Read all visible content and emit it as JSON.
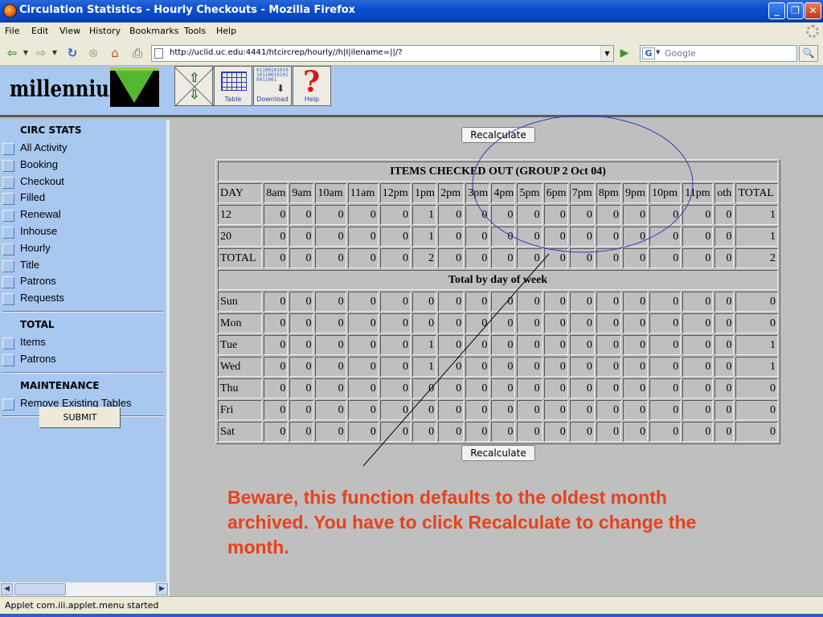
{
  "window": {
    "title": "Circulation Statistics - Hourly Checkouts - Mozilla Firefox"
  },
  "menubar": [
    "File",
    "Edit",
    "View",
    "History",
    "Bookmarks",
    "Tools",
    "Help"
  ],
  "nav": {
    "url": "http://uclid.uc.edu:4441/htcircrep/hourly//h|I|ilename=||/?",
    "search_placeholder": "Google",
    "search_engine_glyph": "G"
  },
  "header": {
    "logo_text": "millennium",
    "tools": {
      "table": "Table",
      "download": "Download",
      "help": "Help"
    },
    "download_bits": "01100101010101100101010011001"
  },
  "sidebar": {
    "sections": [
      {
        "title": "CIRC STATS",
        "items": [
          "All Activity",
          "Booking",
          "Checkout",
          "Filled",
          "Renewal",
          "Inhouse",
          "Hourly",
          "Title",
          "Patrons",
          "Requests"
        ]
      },
      {
        "title": "TOTAL",
        "items": [
          "Items",
          "Patrons"
        ]
      },
      {
        "title": "MAINTENANCE",
        "items": [
          "Remove Existing Tables"
        ]
      }
    ],
    "submit_label": "SUBMIT"
  },
  "main": {
    "recalculate_label": "Recalculate",
    "table": {
      "caption": "ITEMS CHECKED OUT (GROUP 2 Oct 04)",
      "columns": [
        "DAY",
        "8am",
        "9am",
        "10am",
        "11am",
        "12pm",
        "1pm",
        "2pm",
        "3pm",
        "4pm",
        "5pm",
        "6pm",
        "7pm",
        "8pm",
        "9pm",
        "10pm",
        "11pm",
        "oth",
        "TOTAL"
      ],
      "rows": [
        [
          "12",
          "0",
          "0",
          "0",
          "0",
          "0",
          "1",
          "0",
          "0",
          "0",
          "0",
          "0",
          "0",
          "0",
          "0",
          "0",
          "0",
          "0",
          "1"
        ],
        [
          "20",
          "0",
          "0",
          "0",
          "0",
          "0",
          "1",
          "0",
          "0",
          "0",
          "0",
          "0",
          "0",
          "0",
          "0",
          "0",
          "0",
          "0",
          "1"
        ],
        [
          "TOTAL",
          "0",
          "0",
          "0",
          "0",
          "0",
          "2",
          "0",
          "0",
          "0",
          "0",
          "0",
          "0",
          "0",
          "0",
          "0",
          "0",
          "0",
          "2"
        ]
      ],
      "week_caption": "Total by day of week",
      "week_rows": [
        [
          "Sun",
          "0",
          "0",
          "0",
          "0",
          "0",
          "0",
          "0",
          "0",
          "0",
          "0",
          "0",
          "0",
          "0",
          "0",
          "0",
          "0",
          "0",
          "0"
        ],
        [
          "Mon",
          "0",
          "0",
          "0",
          "0",
          "0",
          "0",
          "0",
          "0",
          "0",
          "0",
          "0",
          "0",
          "0",
          "0",
          "0",
          "0",
          "0",
          "0"
        ],
        [
          "Tue",
          "0",
          "0",
          "0",
          "0",
          "0",
          "1",
          "0",
          "0",
          "0",
          "0",
          "0",
          "0",
          "0",
          "0",
          "0",
          "0",
          "0",
          "1"
        ],
        [
          "Wed",
          "0",
          "0",
          "0",
          "0",
          "0",
          "1",
          "0",
          "0",
          "0",
          "0",
          "0",
          "0",
          "0",
          "0",
          "0",
          "0",
          "0",
          "1"
        ],
        [
          "Thu",
          "0",
          "0",
          "0",
          "0",
          "0",
          "0",
          "0",
          "0",
          "0",
          "0",
          "0",
          "0",
          "0",
          "0",
          "0",
          "0",
          "0",
          "0"
        ],
        [
          "Fri",
          "0",
          "0",
          "0",
          "0",
          "0",
          "0",
          "0",
          "0",
          "0",
          "0",
          "0",
          "0",
          "0",
          "0",
          "0",
          "0",
          "0",
          "0"
        ],
        [
          "Sat",
          "0",
          "0",
          "0",
          "0",
          "0",
          "0",
          "0",
          "0",
          "0",
          "0",
          "0",
          "0",
          "0",
          "0",
          "0",
          "0",
          "0",
          "0"
        ]
      ]
    },
    "annotation": {
      "text": "Beware, this function defaults to the oldest month archived. You have to click Recalculate to change the month.",
      "text_color": "#E8411A",
      "oval_color": "#3A3AB8"
    }
  },
  "status": {
    "text": "Applet com.iii.applet.menu started"
  }
}
